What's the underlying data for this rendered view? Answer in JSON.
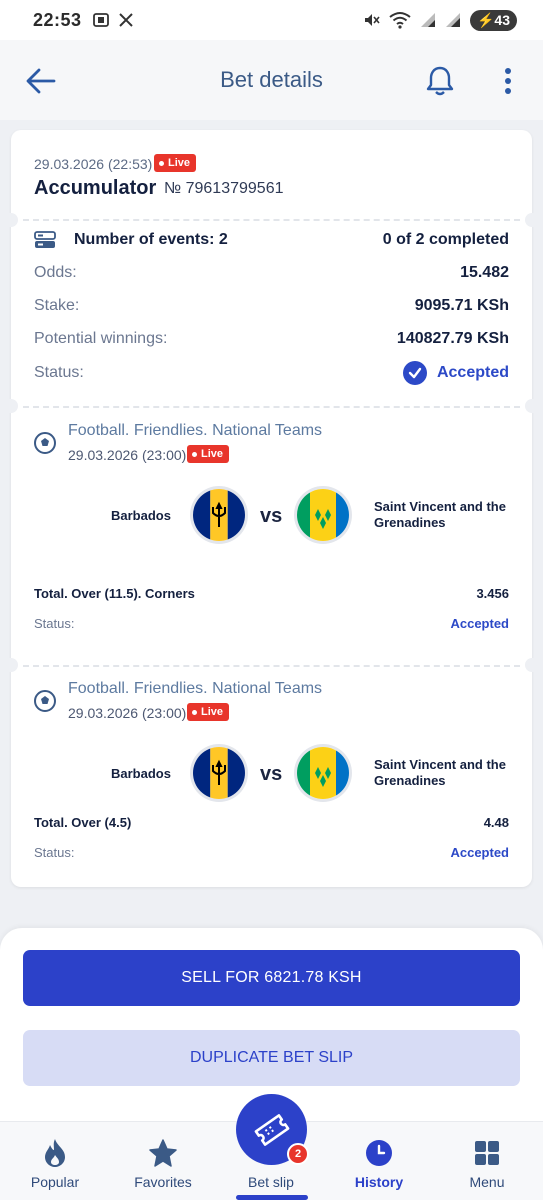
{
  "status_bar": {
    "time": "22:53",
    "battery": "43"
  },
  "header": {
    "title": "Bet details"
  },
  "bet": {
    "date": "29.03.2026 (22:53)",
    "live_label": "Live",
    "type": "Accumulator",
    "number": "№ 79613799561",
    "events_label": "Number of events: 2",
    "completed": "0 of 2 completed",
    "odds_label": "Odds:",
    "odds": "15.482",
    "stake_label": "Stake:",
    "stake": "9095.71 KSh",
    "winnings_label": "Potential winnings:",
    "winnings": "140827.79 KSh",
    "status_label": "Status:",
    "status": "Accepted"
  },
  "events": [
    {
      "league": "Football. Friendlies. National Teams",
      "date": "29.03.2026 (23:00)",
      "live_label": "Live",
      "home": "Barbados",
      "vs": "vs",
      "away_line1": "Saint Vincent and the",
      "away_line2": "Grenadines",
      "market": "Total. Over (11.5). Corners",
      "odds": "3.456",
      "status_label": "Status:",
      "status": "Accepted"
    },
    {
      "league": "Football. Friendlies. National Teams",
      "date": "29.03.2026 (23:00)",
      "live_label": "Live",
      "home": "Barbados",
      "vs": "vs",
      "away_line1": "Saint Vincent and the",
      "away_line2": "Grenadines",
      "market": "Total. Over (4.5)",
      "odds": "4.48",
      "status_label": "Status:",
      "status": "Accepted"
    }
  ],
  "actions": {
    "sell": "SELL FOR 6821.78 KSH",
    "duplicate": "DUPLICATE BET SLIP"
  },
  "nav": {
    "items": [
      {
        "label": "Popular",
        "icon": "flame-icon"
      },
      {
        "label": "Favorites",
        "icon": "star-icon"
      },
      {
        "label": "Bet slip",
        "icon": "ticket-icon",
        "badge": "2"
      },
      {
        "label": "History",
        "icon": "clock-icon"
      },
      {
        "label": "Menu",
        "icon": "grid-icon"
      }
    ]
  },
  "colors": {
    "accent": "#2c41c9",
    "live": "#e8352b",
    "title": "#3b5a86",
    "accepted": "#2c49c7"
  }
}
